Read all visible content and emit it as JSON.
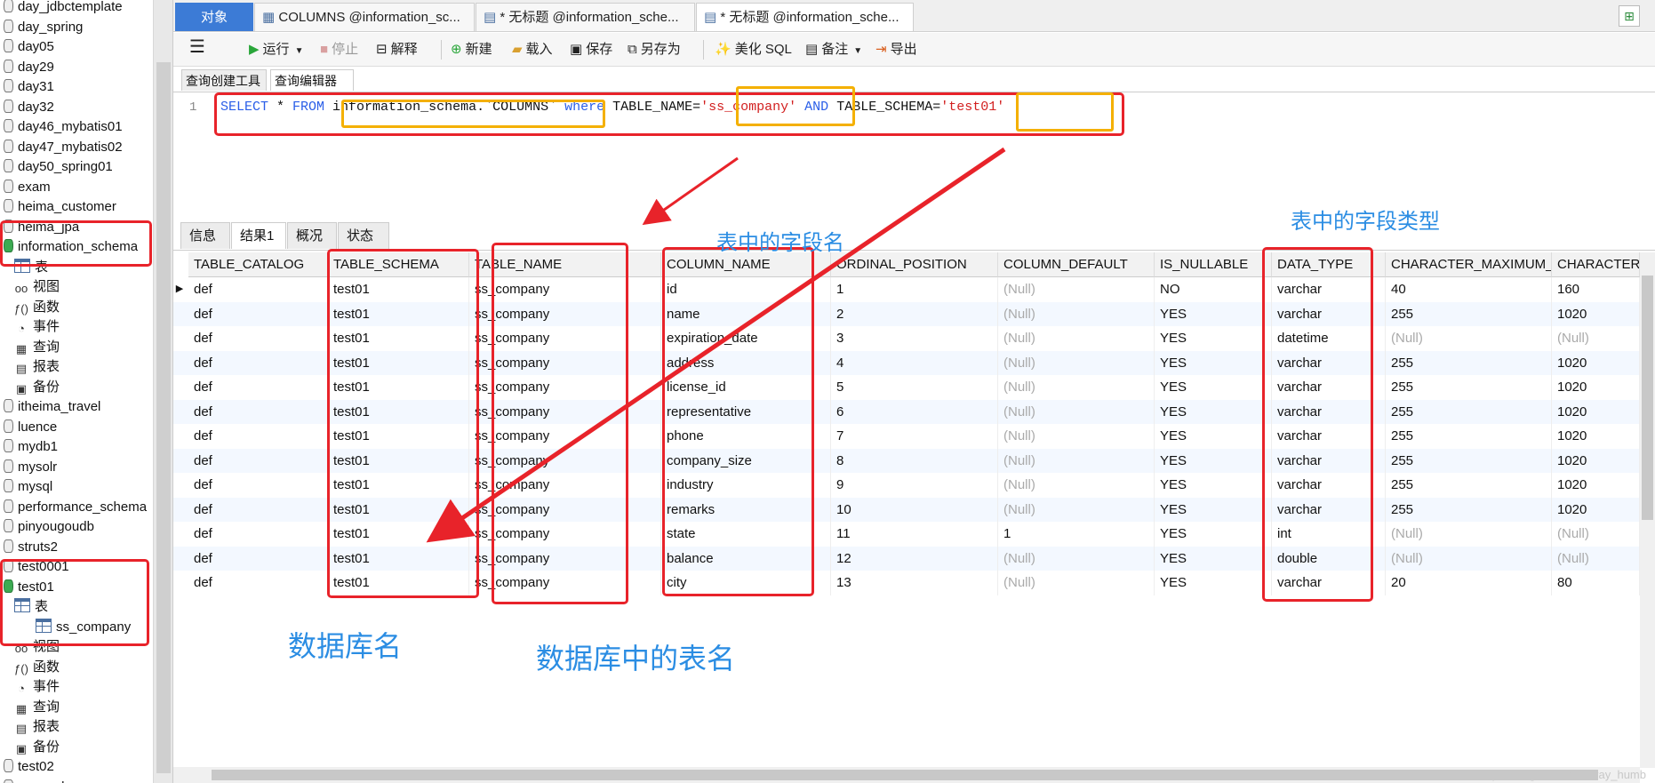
{
  "sidebar": {
    "items": [
      {
        "label": "day_jdbctemplate",
        "type": "db"
      },
      {
        "label": "day_spring",
        "type": "db"
      },
      {
        "label": "day05",
        "type": "db"
      },
      {
        "label": "day29",
        "type": "db"
      },
      {
        "label": "day31",
        "type": "db"
      },
      {
        "label": "day32",
        "type": "db"
      },
      {
        "label": "day46_mybatis01",
        "type": "db"
      },
      {
        "label": "day47_mybatis02",
        "type": "db"
      },
      {
        "label": "day50_spring01",
        "type": "db"
      },
      {
        "label": "exam",
        "type": "db"
      },
      {
        "label": "heima_customer",
        "type": "db"
      },
      {
        "label": "heima_jpa",
        "type": "db"
      },
      {
        "label": "information_schema",
        "type": "db-open"
      },
      {
        "label": "表",
        "type": "tables"
      },
      {
        "label": "视图",
        "type": "views"
      },
      {
        "label": "函数",
        "type": "func"
      },
      {
        "label": "事件",
        "type": "event"
      },
      {
        "label": "查询",
        "type": "query"
      },
      {
        "label": "报表",
        "type": "report"
      },
      {
        "label": "备份",
        "type": "backup"
      },
      {
        "label": "itheima_travel",
        "type": "db"
      },
      {
        "label": "luence",
        "type": "db"
      },
      {
        "label": "mydb1",
        "type": "db"
      },
      {
        "label": "mysolr",
        "type": "db"
      },
      {
        "label": "mysql",
        "type": "db"
      },
      {
        "label": "performance_schema",
        "type": "db"
      },
      {
        "label": "pinyougoudb",
        "type": "db"
      },
      {
        "label": "struts2",
        "type": "db"
      },
      {
        "label": "test0001",
        "type": "db"
      },
      {
        "label": "test01",
        "type": "db-open"
      },
      {
        "label": "表",
        "type": "tables"
      },
      {
        "label": "ss_company",
        "type": "table"
      },
      {
        "label": "视图",
        "type": "views"
      },
      {
        "label": "函数",
        "type": "func"
      },
      {
        "label": "事件",
        "type": "event"
      },
      {
        "label": "查询",
        "type": "query"
      },
      {
        "label": "报表",
        "type": "report"
      },
      {
        "label": "备份",
        "type": "backup"
      },
      {
        "label": "test02",
        "type": "db"
      },
      {
        "label": "myoracle",
        "type": "db"
      }
    ]
  },
  "tabs": {
    "objects": "对象",
    "tab1": "COLUMNS @information_sc...",
    "tab2": "* 无标题 @information_sche...",
    "tab3": "* 无标题 @information_sche..."
  },
  "toolbar": {
    "run": "运行",
    "stop": "停止",
    "explain": "解释",
    "new": "新建",
    "load": "载入",
    "save": "保存",
    "save_as": "另存为",
    "beautify": "美化 SQL",
    "comment": "备注",
    "export": "导出"
  },
  "editor_tabs": {
    "builder": "查询创建工具",
    "editor": "查询编辑器"
  },
  "editor": {
    "line_no": "1",
    "sql": {
      "kw_select": "SELECT",
      "star": " * ",
      "kw_from": "FROM",
      "from_target": " information_schema.`COLUMNS` ",
      "kw_where": "where",
      "cond1": " TABLE_NAME=",
      "val1": "'ss_company'",
      "kw_and": " AND",
      "cond2": " TABLE_SCHEMA=",
      "val2": "'test01'"
    }
  },
  "result_tabs": {
    "info": "信息",
    "result": "结果1",
    "profile": "概况",
    "status": "状态"
  },
  "grid": {
    "columns": [
      "TABLE_CATALOG",
      "TABLE_SCHEMA",
      "TABLE_NAME",
      "COLUMN_NAME",
      "ORDINAL_POSITION",
      "COLUMN_DEFAULT",
      "IS_NULLABLE",
      "DATA_TYPE",
      "CHARACTER_MAXIMUM_",
      "CHARACTER"
    ],
    "rows": [
      [
        "def",
        "test01",
        "ss_company",
        "id",
        "1",
        "(Null)",
        "NO",
        "varchar",
        "40",
        "160"
      ],
      [
        "def",
        "test01",
        "ss_company",
        "name",
        "2",
        "(Null)",
        "YES",
        "varchar",
        "255",
        "1020"
      ],
      [
        "def",
        "test01",
        "ss_company",
        "expiration_date",
        "3",
        "(Null)",
        "YES",
        "datetime",
        "(Null)",
        "(Null)"
      ],
      [
        "def",
        "test01",
        "ss_company",
        "address",
        "4",
        "(Null)",
        "YES",
        "varchar",
        "255",
        "1020"
      ],
      [
        "def",
        "test01",
        "ss_company",
        "license_id",
        "5",
        "(Null)",
        "YES",
        "varchar",
        "255",
        "1020"
      ],
      [
        "def",
        "test01",
        "ss_company",
        "representative",
        "6",
        "(Null)",
        "YES",
        "varchar",
        "255",
        "1020"
      ],
      [
        "def",
        "test01",
        "ss_company",
        "phone",
        "7",
        "(Null)",
        "YES",
        "varchar",
        "255",
        "1020"
      ],
      [
        "def",
        "test01",
        "ss_company",
        "company_size",
        "8",
        "(Null)",
        "YES",
        "varchar",
        "255",
        "1020"
      ],
      [
        "def",
        "test01",
        "ss_company",
        "industry",
        "9",
        "(Null)",
        "YES",
        "varchar",
        "255",
        "1020"
      ],
      [
        "def",
        "test01",
        "ss_company",
        "remarks",
        "10",
        "(Null)",
        "YES",
        "varchar",
        "255",
        "1020"
      ],
      [
        "def",
        "test01",
        "ss_company",
        "state",
        "11",
        "1",
        "YES",
        "int",
        "(Null)",
        "(Null)"
      ],
      [
        "def",
        "test01",
        "ss_company",
        "balance",
        "12",
        "(Null)",
        "YES",
        "double",
        "(Null)",
        "(Null)"
      ],
      [
        "def",
        "test01",
        "ss_company",
        "city",
        "13",
        "(Null)",
        "YES",
        "varchar",
        "20",
        "80"
      ]
    ]
  },
  "annotations": {
    "field_name": "表中的字段名",
    "field_type": "表中的字段类型",
    "db_name": "数据库名",
    "table_name": "数据库中的表名"
  },
  "watermark": "https://blog.csdn.net/Gray_humb",
  "colors": {
    "annotation_red": "#e8232a",
    "annotation_orange": "#f4b000",
    "annotation_text": "#2b8de3",
    "objects_tab": "#3c7bd6"
  }
}
